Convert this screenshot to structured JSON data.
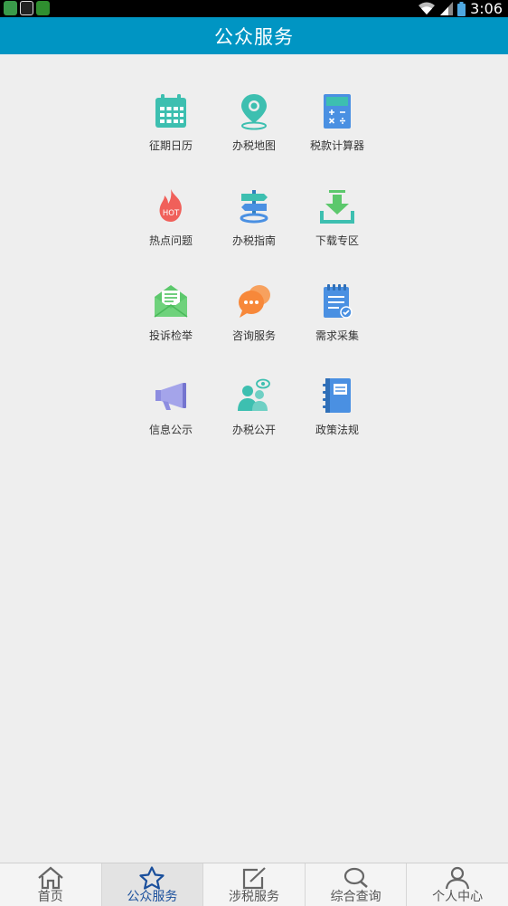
{
  "status_bar": {
    "time": "3:06"
  },
  "header": {
    "title": "公众服务"
  },
  "grid": {
    "items": [
      {
        "label": "征期日历",
        "icon": "calendar-icon"
      },
      {
        "label": "办税地图",
        "icon": "map-pin-icon"
      },
      {
        "label": "税款计算器",
        "icon": "calculator-icon"
      },
      {
        "label": "热点问题",
        "icon": "hot-flame-icon",
        "badge": "HOT"
      },
      {
        "label": "办税指南",
        "icon": "signpost-icon"
      },
      {
        "label": "下载专区",
        "icon": "download-icon"
      },
      {
        "label": "投诉检举",
        "icon": "envelope-icon"
      },
      {
        "label": "咨询服务",
        "icon": "chat-bubbles-icon"
      },
      {
        "label": "需求采集",
        "icon": "notepad-check-icon"
      },
      {
        "label": "信息公示",
        "icon": "megaphone-icon"
      },
      {
        "label": "办税公开",
        "icon": "users-eye-icon"
      },
      {
        "label": "政策法规",
        "icon": "book-icon"
      }
    ]
  },
  "bottom_nav": {
    "items": [
      {
        "label": "首页",
        "icon": "home-icon"
      },
      {
        "label": "公众服务",
        "icon": "star-icon",
        "active": true
      },
      {
        "label": "涉税服务",
        "icon": "edit-icon"
      },
      {
        "label": "综合查询",
        "icon": "search-icon"
      },
      {
        "label": "个人中心",
        "icon": "person-icon"
      }
    ]
  },
  "colors": {
    "title_bar": "#0095c3",
    "active_nav": "#1a4f9c",
    "teal": "#3dbfb0",
    "blue": "#4a90e2",
    "green": "#5cc86c",
    "orange": "#f7883a",
    "red": "#f0605a",
    "purple": "#8d8de0"
  }
}
